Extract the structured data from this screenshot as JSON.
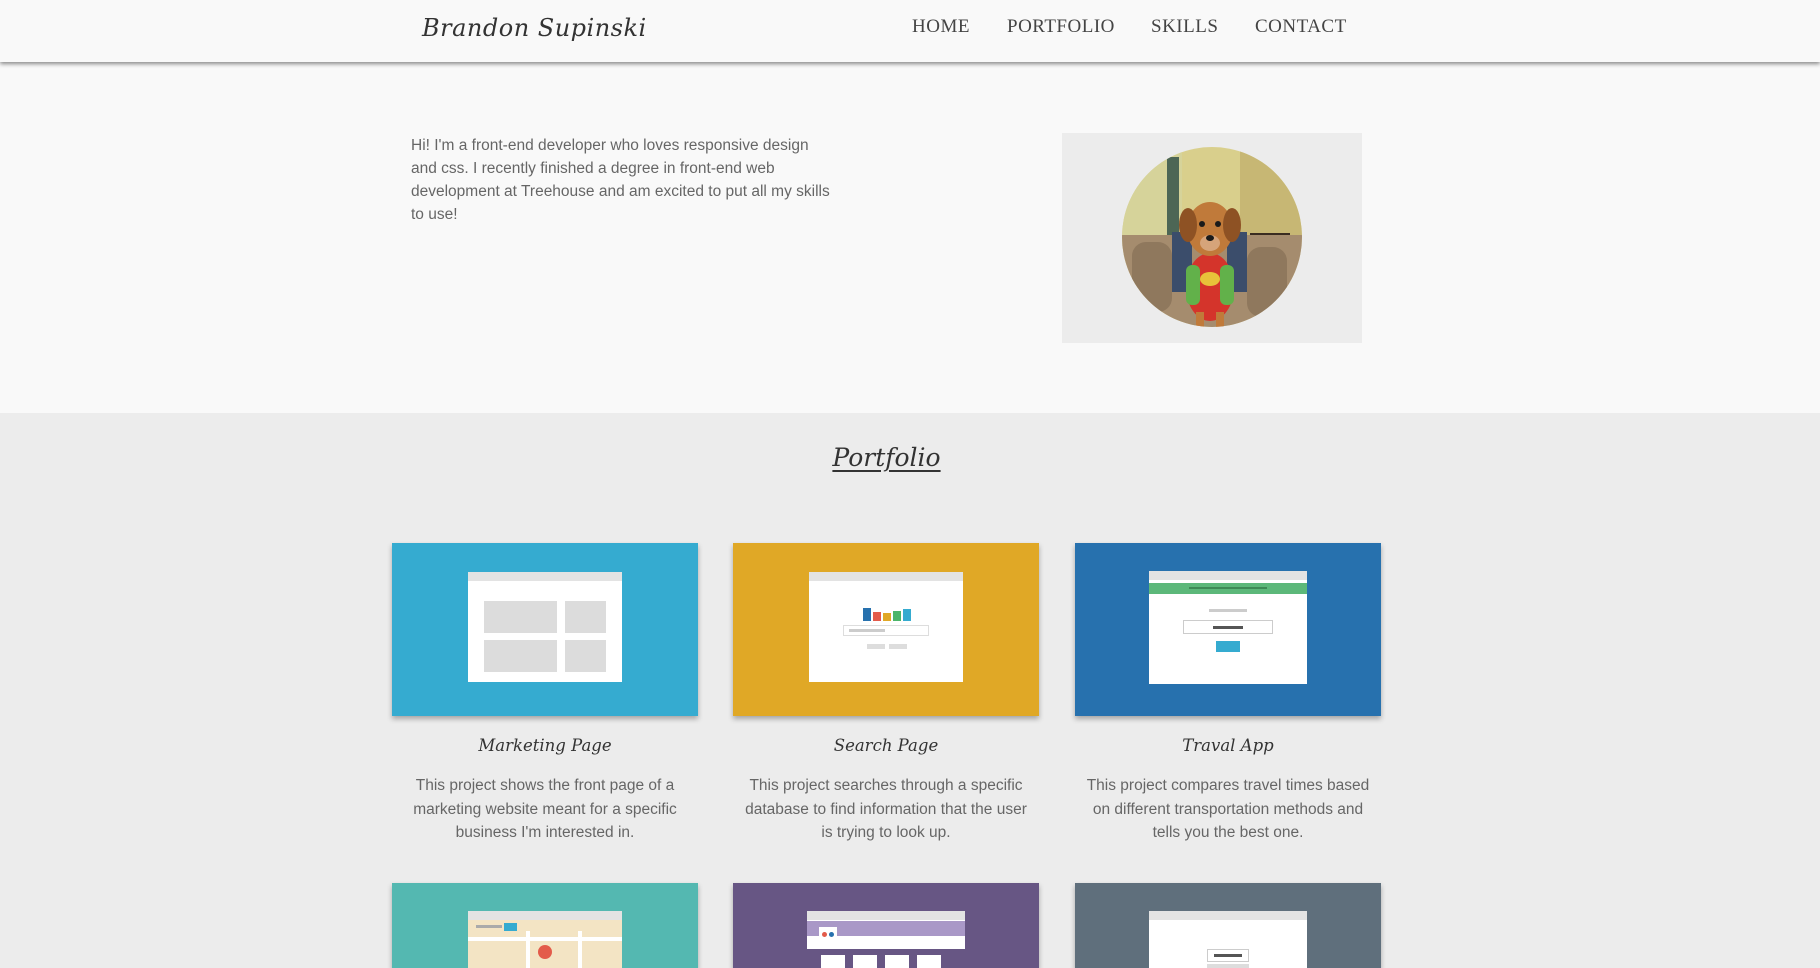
{
  "header": {
    "brand": "Brandon Supinski",
    "nav": [
      "HOME",
      "PORTFOLIO",
      "SKILLS",
      "CONTACT"
    ]
  },
  "hero": {
    "intro": "Hi! I'm a front-end developer who loves responsive design and css. I recently finished a degree in front-end web development at Treehouse and am excited to put all my skills to use!"
  },
  "portfolio": {
    "title": "Portfolio",
    "projects": [
      {
        "title": "Marketing Page",
        "description": "This project shows the front page of a marketing website meant for a specific business I'm interested in.",
        "color": "#35abd0"
      },
      {
        "title": "Search Page",
        "description": "This project searches through a specific database to find information that the user is trying to look up.",
        "color": "#e0a826"
      },
      {
        "title": "Traval App",
        "description": "This project compares travel times based on different transportation methods and tells you the best one.",
        "color": "#2771ae"
      },
      {
        "title": "",
        "description": "",
        "color": "#54b8b1"
      },
      {
        "title": "",
        "description": "",
        "color": "#675684"
      },
      {
        "title": "",
        "description": "",
        "color": "#5f6f7c"
      }
    ]
  },
  "colors": {
    "page_bg": "#ececec",
    "hero_bg": "#f9f9f9",
    "text": "#666666",
    "heading": "#333333"
  }
}
